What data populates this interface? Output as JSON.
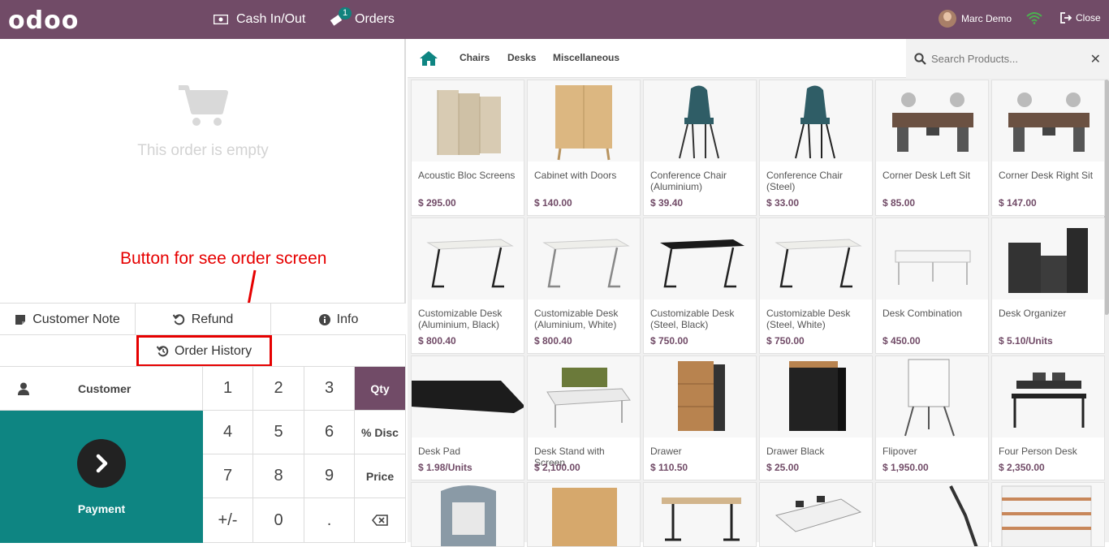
{
  "header": {
    "logo": "odoo",
    "cash_label": "Cash In/Out",
    "orders_label": "Orders",
    "orders_badge": "1",
    "user_name": "Marc Demo",
    "close_label": "Close"
  },
  "order": {
    "empty_text": "This order is empty"
  },
  "annotation": {
    "text": "Button for see order screen"
  },
  "controls": {
    "customer_note": "Customer Note",
    "refund": "Refund",
    "info": "Info",
    "order_history": "Order History"
  },
  "pad": {
    "customer": "Customer",
    "payment": "Payment",
    "keys": [
      "1",
      "2",
      "3",
      "Qty",
      "4",
      "5",
      "6",
      "% Disc",
      "7",
      "8",
      "9",
      "Price",
      "+/-",
      "0",
      ".",
      ""
    ]
  },
  "categories": {
    "items": [
      "Chairs",
      "Desks",
      "Miscellaneous"
    ]
  },
  "search": {
    "placeholder": "Search Products..."
  },
  "products": [
    {
      "name": "Acoustic Bloc Screens",
      "price": "$ 295.00"
    },
    {
      "name": "Cabinet with Doors",
      "price": "$ 140.00"
    },
    {
      "name": "Conference Chair (Aluminium)",
      "price": "$ 39.40"
    },
    {
      "name": "Conference Chair (Steel)",
      "price": "$ 33.00"
    },
    {
      "name": "Corner Desk Left Sit",
      "price": "$ 85.00"
    },
    {
      "name": "Corner Desk Right Sit",
      "price": "$ 147.00"
    },
    {
      "name": "Customizable Desk (Aluminium, Black)",
      "price": "$ 800.40"
    },
    {
      "name": "Customizable Desk (Aluminium, White)",
      "price": "$ 800.40"
    },
    {
      "name": "Customizable Desk (Steel, Black)",
      "price": "$ 750.00"
    },
    {
      "name": "Customizable Desk (Steel, White)",
      "price": "$ 750.00"
    },
    {
      "name": "Desk Combination",
      "price": "$ 450.00"
    },
    {
      "name": "Desk Organizer",
      "price": "$ 5.10/Units"
    },
    {
      "name": "Desk Pad",
      "price": "$ 1.98/Units"
    },
    {
      "name": "Desk Stand with Screen",
      "price": "$ 2,100.00"
    },
    {
      "name": "Drawer",
      "price": "$ 110.50"
    },
    {
      "name": "Drawer Black",
      "price": "$ 25.00"
    },
    {
      "name": "Flipover",
      "price": "$ 1,950.00"
    },
    {
      "name": "Four Person Desk",
      "price": "$ 2,350.00"
    }
  ],
  "colors": {
    "brand": "#714b67",
    "payment": "#0e8582",
    "annotation": "#e60000"
  }
}
